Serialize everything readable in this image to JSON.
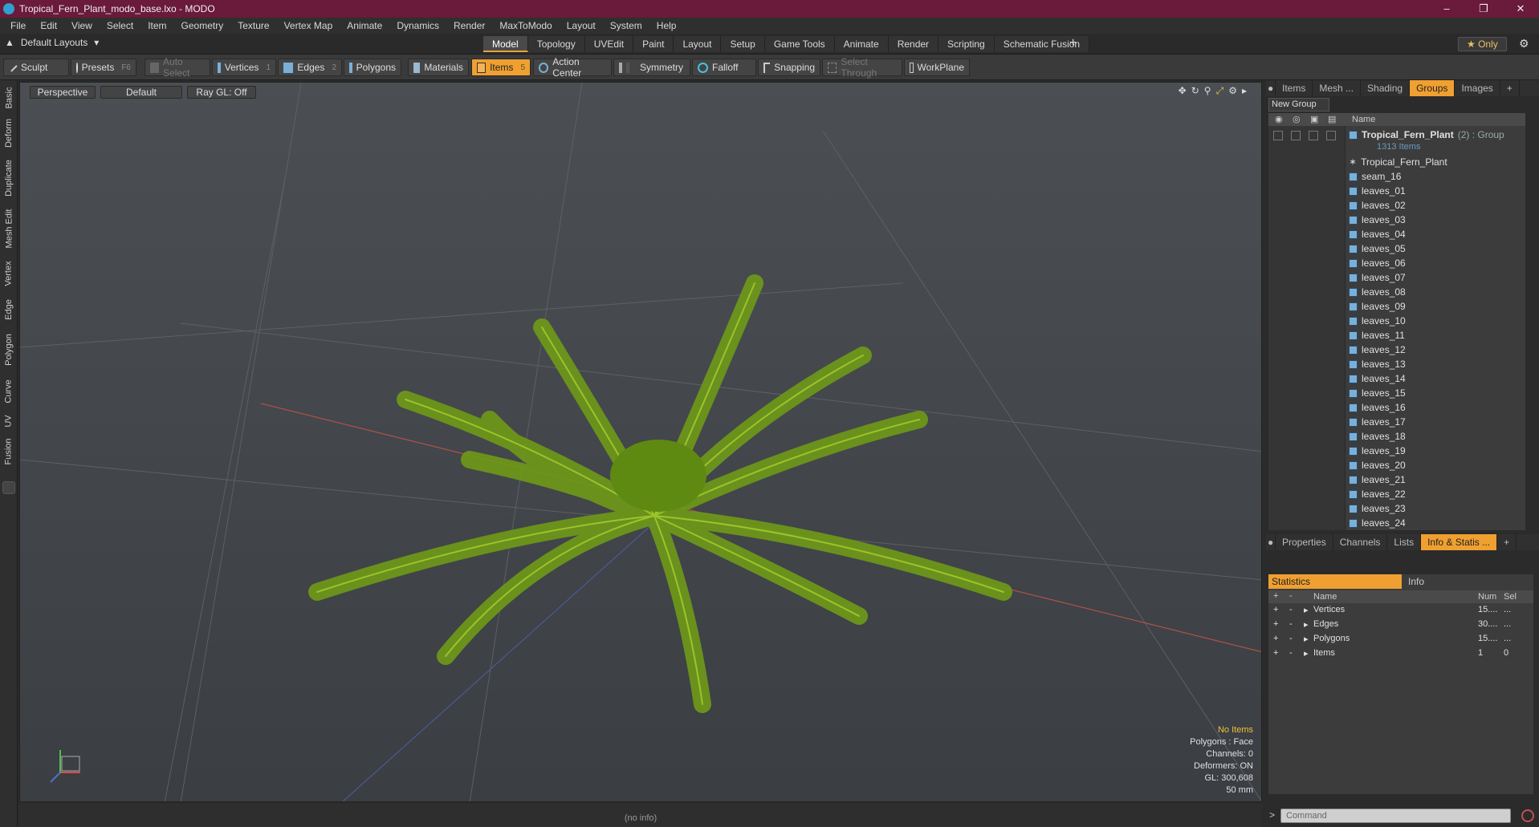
{
  "window": {
    "title": "Tropical_Fern_Plant_modo_base.lxo - MODO",
    "controls": [
      "–",
      "❐",
      "✕"
    ]
  },
  "menu": [
    "File",
    "Edit",
    "View",
    "Select",
    "Item",
    "Geometry",
    "Texture",
    "Vertex Map",
    "Animate",
    "Dynamics",
    "Render",
    "MaxToModo",
    "Layout",
    "System",
    "Help"
  ],
  "layoutbar": {
    "layout_dropdown": "Default Layouts",
    "tabs": [
      "Model",
      "Topology",
      "UVEdit",
      "Paint",
      "Layout",
      "Setup",
      "Game Tools",
      "Animate",
      "Render",
      "Scripting",
      "Schematic Fusion"
    ],
    "active_tab": "Model",
    "only_label": "★ Only"
  },
  "toolbar": {
    "sculpt": "Sculpt",
    "presets": "Presets",
    "presets_key": "F6",
    "auto_select": "Auto Select",
    "vertices": "Vertices",
    "vertices_key": "1",
    "edges": "Edges",
    "edges_key": "2",
    "polygons": "Polygons",
    "materials": "Materials",
    "items": "Items",
    "items_key": "5",
    "action_center": "Action Center",
    "symmetry": "Symmetry",
    "falloff": "Falloff",
    "snapping": "Snapping",
    "select_through": "Select Through",
    "workplane": "WorkPlane"
  },
  "left_tabs": [
    "Basic",
    "Deform",
    "Duplicate",
    "Mesh Edit",
    "Vertex",
    "Edge",
    "Polygon",
    "Curve",
    "UV",
    "Fusion"
  ],
  "viewport": {
    "view": "Perspective",
    "shading": "Default",
    "raygl": "Ray GL: Off",
    "hud": {
      "no_items": "No Items",
      "polygons": "Polygons : Face",
      "channels": "Channels: 0",
      "deformers": "Deformers: ON",
      "gl": "GL: 300,608",
      "scale": "50 mm"
    },
    "status": "(no info)"
  },
  "right_panel": {
    "tabs": [
      "Items",
      "Mesh ...",
      "Shading",
      "Groups",
      "Images"
    ],
    "active_tab": "Groups",
    "new_group": "New Group",
    "column_name": "Name",
    "group": {
      "name": "Tropical_Fern_Plant",
      "suffix": "(2) : Group",
      "count": "1313 Items"
    },
    "items": [
      "Tropical_Fern_Plant",
      "seam_16",
      "leaves_01",
      "leaves_02",
      "leaves_03",
      "leaves_04",
      "leaves_05",
      "leaves_06",
      "leaves_07",
      "leaves_08",
      "leaves_09",
      "leaves_10",
      "leaves_11",
      "leaves_12",
      "leaves_13",
      "leaves_14",
      "leaves_15",
      "leaves_16",
      "leaves_17",
      "leaves_18",
      "leaves_19",
      "leaves_20",
      "leaves_21",
      "leaves_22",
      "leaves_23",
      "leaves_24"
    ],
    "bottom_tabs": [
      "Properties",
      "Channels",
      "Lists",
      "Info & Statis ..."
    ],
    "bottom_active": "Info & Statis ...",
    "stat_tabs": [
      "Statistics",
      "Info"
    ],
    "stat_columns": [
      "Name",
      "Num",
      "Sel"
    ],
    "stats": [
      {
        "name": "Vertices",
        "num": "15....",
        "sel": "..."
      },
      {
        "name": "Edges",
        "num": "30....",
        "sel": "..."
      },
      {
        "name": "Polygons",
        "num": "15....",
        "sel": "..."
      },
      {
        "name": "Items",
        "num": "1",
        "sel": "0"
      }
    ],
    "command_placeholder": "Command"
  },
  "colors": {
    "titlebar": "#6a1a3a",
    "accent": "#f0a030",
    "fern": "#7fa81e"
  }
}
